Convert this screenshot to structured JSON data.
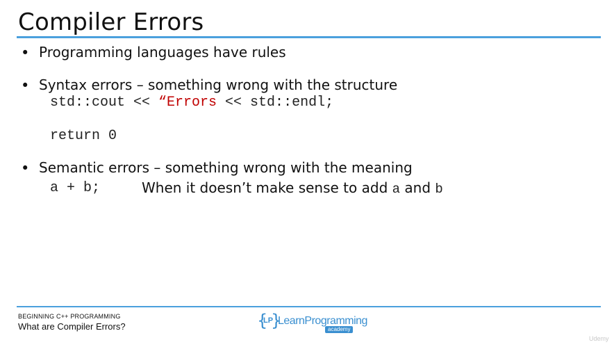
{
  "slide": {
    "title": "Compiler Errors",
    "bullets": [
      {
        "marker": "•",
        "text": "Programming languages have rules"
      },
      {
        "marker": "•",
        "text": "Syntax errors – something wrong with the structure"
      },
      {
        "marker": "•",
        "text": "Semantic errors – something wrong with the meaning"
      }
    ],
    "syntax_code": {
      "line1_before": "std::cout << ",
      "line1_error": "“Errors",
      "line1_after": " << std::endl;",
      "line2": "return 0"
    },
    "semantic_code": {
      "expression": "a + b;",
      "explain_text": "When it doesn’t make sense to add ",
      "var_a": "a",
      "and_text": " and ",
      "var_b": "b"
    }
  },
  "footer": {
    "course": "BEGINNING C++ PROGRAMMING",
    "lesson": "What are Compiler Errors?",
    "logo": {
      "left_brace": "{",
      "initials": "LP",
      "right_brace": "}",
      "name": "LearnProgramming",
      "badge": "academy"
    },
    "watermark": "Udemy"
  },
  "colors": {
    "accent": "#4aa0dd",
    "error_red": "#c00000",
    "logo_blue": "#3a8fd0"
  }
}
